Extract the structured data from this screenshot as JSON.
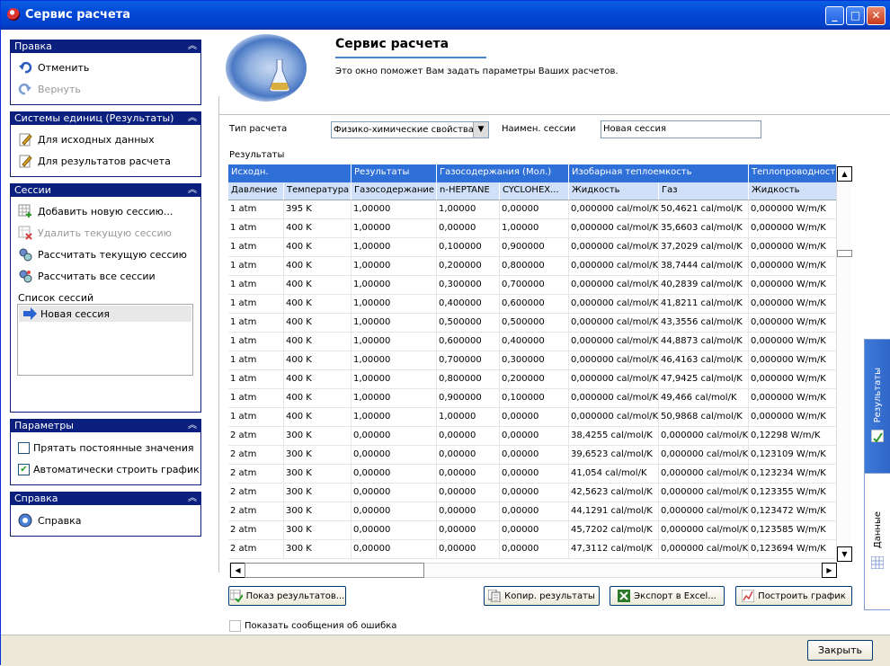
{
  "window": {
    "title": "Сервис расчета"
  },
  "titlebar": {
    "minimize": "_",
    "maximize": "□",
    "close": "✕"
  },
  "left": {
    "edit": {
      "title": "Правка",
      "undo": "Отменить",
      "redo": "Вернуть"
    },
    "units": {
      "title": "Системы единиц (Результаты)",
      "input": "Для исходных данных",
      "results": "Для результатов расчета"
    },
    "sessions": {
      "title": "Сессии",
      "add": "Добавить новую сессию...",
      "delete": "Удалить текущую сессию",
      "calc_current": "Рассчитать текущую сессию",
      "calc_all": "Рассчитать все сессии",
      "list_label": "Список сессий",
      "items": [
        "Новая сессия"
      ]
    },
    "params": {
      "title": "Параметры",
      "hide_const": "Прятать постоянные значения",
      "hide_const_checked": false,
      "auto_plot": "Автоматически строить график",
      "auto_plot_checked": true
    },
    "help": {
      "title": "Справка",
      "help": "Справка"
    }
  },
  "banner": {
    "title": "Сервис расчета",
    "subtitle": "Это окно поможет Вам задать параметры Ваших расчетов."
  },
  "form": {
    "calc_type_label": "Тип расчета",
    "calc_type_value": "Физико-химические свойства",
    "session_name_label": "Наимен. сессии",
    "session_name_value": "Новая сессия",
    "results_label": "Результаты"
  },
  "grid": {
    "groups": [
      "Исходн.",
      "Результаты",
      "Газосодержания (Мол.)",
      "Изобарная теплоемкость",
      "Теплопроводность"
    ],
    "columns": [
      "Давление",
      "Температура",
      "Газосодержание",
      "n-HEPTANE",
      "CYCLOHEX...",
      "Жидкость",
      "Газ",
      "Жидкость"
    ],
    "rows": [
      [
        "1 atm",
        "395 K",
        "1,00000",
        "1,00000",
        "0,00000",
        "0,000000 cal/mol/K",
        "50,4621 cal/mol/K",
        "0,000000 W/m/K"
      ],
      [
        "1 atm",
        "400 K",
        "1,00000",
        "0,00000",
        "1,00000",
        "0,000000 cal/mol/K",
        "35,6603 cal/mol/K",
        "0,000000 W/m/K"
      ],
      [
        "1 atm",
        "400 K",
        "1,00000",
        "0,100000",
        "0,900000",
        "0,000000 cal/mol/K",
        "37,2029 cal/mol/K",
        "0,000000 W/m/K"
      ],
      [
        "1 atm",
        "400 K",
        "1,00000",
        "0,200000",
        "0,800000",
        "0,000000 cal/mol/K",
        "38,7444 cal/mol/K",
        "0,000000 W/m/K"
      ],
      [
        "1 atm",
        "400 K",
        "1,00000",
        "0,300000",
        "0,700000",
        "0,000000 cal/mol/K",
        "40,2839 cal/mol/K",
        "0,000000 W/m/K"
      ],
      [
        "1 atm",
        "400 K",
        "1,00000",
        "0,400000",
        "0,600000",
        "0,000000 cal/mol/K",
        "41,8211 cal/mol/K",
        "0,000000 W/m/K"
      ],
      [
        "1 atm",
        "400 K",
        "1,00000",
        "0,500000",
        "0,500000",
        "0,000000 cal/mol/K",
        "43,3556 cal/mol/K",
        "0,000000 W/m/K"
      ],
      [
        "1 atm",
        "400 K",
        "1,00000",
        "0,600000",
        "0,400000",
        "0,000000 cal/mol/K",
        "44,8873 cal/mol/K",
        "0,000000 W/m/K"
      ],
      [
        "1 atm",
        "400 K",
        "1,00000",
        "0,700000",
        "0,300000",
        "0,000000 cal/mol/K",
        "46,4163 cal/mol/K",
        "0,000000 W/m/K"
      ],
      [
        "1 atm",
        "400 K",
        "1,00000",
        "0,800000",
        "0,200000",
        "0,000000 cal/mol/K",
        "47,9425 cal/mol/K",
        "0,000000 W/m/K"
      ],
      [
        "1 atm",
        "400 K",
        "1,00000",
        "0,900000",
        "0,100000",
        "0,000000 cal/mol/K",
        "49,466 cal/mol/K",
        "0,000000 W/m/K"
      ],
      [
        "1 atm",
        "400 K",
        "1,00000",
        "1,00000",
        "0,00000",
        "0,000000 cal/mol/K",
        "50,9868 cal/mol/K",
        "0,000000 W/m/K"
      ],
      [
        "2 atm",
        "300 K",
        "0,00000",
        "0,00000",
        "0,00000",
        "38,4255 cal/mol/K",
        "0,000000 cal/mol/K",
        "0,12298 W/m/K"
      ],
      [
        "2 atm",
        "300 K",
        "0,00000",
        "0,00000",
        "0,00000",
        "39,6523 cal/mol/K",
        "0,000000 cal/mol/K",
        "0,123109 W/m/K"
      ],
      [
        "2 atm",
        "300 K",
        "0,00000",
        "0,00000",
        "0,00000",
        "41,054 cal/mol/K",
        "0,000000 cal/mol/K",
        "0,123234 W/m/K"
      ],
      [
        "2 atm",
        "300 K",
        "0,00000",
        "0,00000",
        "0,00000",
        "42,5623 cal/mol/K",
        "0,000000 cal/mol/K",
        "0,123355 W/m/K"
      ],
      [
        "2 atm",
        "300 K",
        "0,00000",
        "0,00000",
        "0,00000",
        "44,1291 cal/mol/K",
        "0,000000 cal/mol/K",
        "0,123472 W/m/K"
      ],
      [
        "2 atm",
        "300 K",
        "0,00000",
        "0,00000",
        "0,00000",
        "45,7202 cal/mol/K",
        "0,000000 cal/mol/K",
        "0,123585 W/m/K"
      ],
      [
        "2 atm",
        "300 K",
        "0,00000",
        "0,00000",
        "0,00000",
        "47,3112 cal/mol/K",
        "0,000000 cal/mol/K",
        "0,123694 W/m/K"
      ]
    ]
  },
  "buttons": {
    "show_results": "Показ результатов...",
    "copy": "Копир. результаты",
    "export": "Экспорт в Excel...",
    "plot": "Построить график",
    "close": "Закрыть"
  },
  "show_errors": "Показать сообщения об ошибка",
  "side_tabs": {
    "results": "Результаты",
    "data": "Данные"
  },
  "colors": {
    "group_header": "#0a1f7e",
    "grid_header": "#2f6fd8",
    "titlebar": "#0349d8"
  }
}
